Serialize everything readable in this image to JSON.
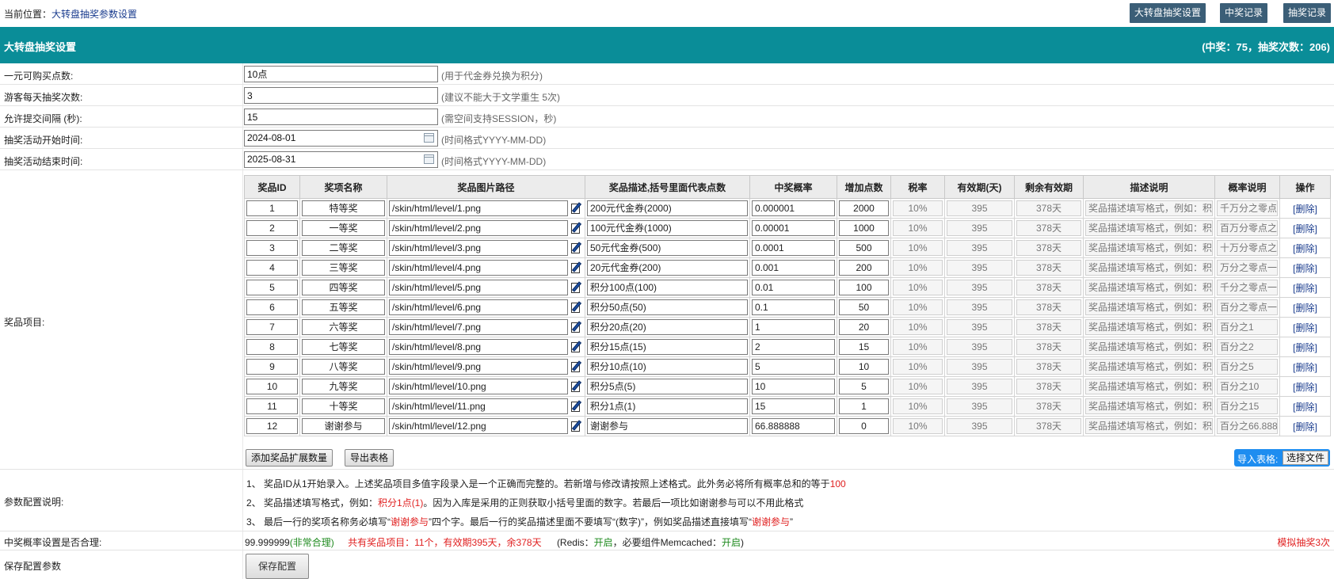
{
  "breadcrumb": {
    "prefix": "当前位置：",
    "link": "大转盘抽奖参数设置"
  },
  "top_buttons": [
    "大转盘抽奖设置",
    "中奖记录",
    "抽奖记录"
  ],
  "panel": {
    "title": "大转盘抽奖设置",
    "stats": "(中奖：75，抽奖次数：206)"
  },
  "fields": [
    {
      "label": "一元可购买点数:",
      "value": "10点",
      "hint": "(用于代金券兑换为积分)"
    },
    {
      "label": "游客每天抽奖次数:",
      "value": "3",
      "hint": "(建议不能大于文学重生 5次)"
    },
    {
      "label": "允许提交间隔 (秒):",
      "value": "15",
      "hint": "(需空间支持SESSION，秒)"
    },
    {
      "label": "抽奖活动开始时间:",
      "value": "2024-08-01",
      "hint": "(时间格式YYYY-MM-DD)"
    },
    {
      "label": "抽奖活动结束时间:",
      "value": "2025-08-31",
      "hint": "(时间格式YYYY-MM-DD)"
    }
  ],
  "prize_section_label": "奖品项目:",
  "table": {
    "headers": [
      "奖品ID",
      "奖项名称",
      "奖品图片路径",
      "奖品描述,括号里面代表点数",
      "中奖概率",
      "增加点数",
      "税率",
      "有效期(天)",
      "剩余有效期",
      "描述说明",
      "概率说明",
      "操作"
    ],
    "rows": [
      {
        "id": "1",
        "name": "特等奖",
        "path": "/skin/html/level/1.png",
        "desc": "200元代金券(2000)",
        "prob": "0.000001",
        "points": "2000",
        "tax": "10%",
        "valid": "395",
        "remain": "378天",
        "explain": "奖品描述填写格式，例如：积",
        "prob_note": "千万分之零点",
        "op": "[删除]"
      },
      {
        "id": "2",
        "name": "一等奖",
        "path": "/skin/html/level/2.png",
        "desc": "100元代金券(1000)",
        "prob": "0.00001",
        "points": "1000",
        "tax": "10%",
        "valid": "395",
        "remain": "378天",
        "explain": "奖品描述填写格式，例如：积",
        "prob_note": "百万分零点之",
        "op": "[删除]"
      },
      {
        "id": "3",
        "name": "二等奖",
        "path": "/skin/html/level/3.png",
        "desc": "50元代金券(500)",
        "prob": "0.0001",
        "points": "500",
        "tax": "10%",
        "valid": "395",
        "remain": "378天",
        "explain": "奖品描述填写格式，例如：积",
        "prob_note": "十万分零点之",
        "op": "[删除]"
      },
      {
        "id": "4",
        "name": "三等奖",
        "path": "/skin/html/level/4.png",
        "desc": "20元代金券(200)",
        "prob": "0.001",
        "points": "200",
        "tax": "10%",
        "valid": "395",
        "remain": "378天",
        "explain": "奖品描述填写格式，例如：积",
        "prob_note": "万分之零点一",
        "op": "[删除]"
      },
      {
        "id": "5",
        "name": "四等奖",
        "path": "/skin/html/level/5.png",
        "desc": "积分100点(100)",
        "prob": "0.01",
        "points": "100",
        "tax": "10%",
        "valid": "395",
        "remain": "378天",
        "explain": "奖品描述填写格式，例如：积",
        "prob_note": "千分之零点一",
        "op": "[删除]"
      },
      {
        "id": "6",
        "name": "五等奖",
        "path": "/skin/html/level/6.png",
        "desc": "积分50点(50)",
        "prob": "0.1",
        "points": "50",
        "tax": "10%",
        "valid": "395",
        "remain": "378天",
        "explain": "奖品描述填写格式，例如：积",
        "prob_note": "百分之零点一",
        "op": "[删除]"
      },
      {
        "id": "7",
        "name": "六等奖",
        "path": "/skin/html/level/7.png",
        "desc": "积分20点(20)",
        "prob": "1",
        "points": "20",
        "tax": "10%",
        "valid": "395",
        "remain": "378天",
        "explain": "奖品描述填写格式，例如：积",
        "prob_note": "百分之1",
        "op": "[删除]"
      },
      {
        "id": "8",
        "name": "七等奖",
        "path": "/skin/html/level/8.png",
        "desc": "积分15点(15)",
        "prob": "2",
        "points": "15",
        "tax": "10%",
        "valid": "395",
        "remain": "378天",
        "explain": "奖品描述填写格式，例如：积",
        "prob_note": "百分之2",
        "op": "[删除]"
      },
      {
        "id": "9",
        "name": "八等奖",
        "path": "/skin/html/level/9.png",
        "desc": "积分10点(10)",
        "prob": "5",
        "points": "10",
        "tax": "10%",
        "valid": "395",
        "remain": "378天",
        "explain": "奖品描述填写格式，例如：积",
        "prob_note": "百分之5",
        "op": "[删除]"
      },
      {
        "id": "10",
        "name": "九等奖",
        "path": "/skin/html/level/10.png",
        "desc": "积分5点(5)",
        "prob": "10",
        "points": "5",
        "tax": "10%",
        "valid": "395",
        "remain": "378天",
        "explain": "奖品描述填写格式，例如：积",
        "prob_note": "百分之10",
        "op": "[删除]"
      },
      {
        "id": "11",
        "name": "十等奖",
        "path": "/skin/html/level/11.png",
        "desc": "积分1点(1)",
        "prob": "15",
        "points": "1",
        "tax": "10%",
        "valid": "395",
        "remain": "378天",
        "explain": "奖品描述填写格式，例如：积",
        "prob_note": "百分之15",
        "op": "[删除]"
      },
      {
        "id": "12",
        "name": "谢谢参与",
        "path": "/skin/html/level/12.png",
        "desc": "谢谢参与",
        "prob": "66.888888",
        "points": "0",
        "tax": "10%",
        "valid": "395",
        "remain": "378天",
        "explain": "奖品描述填写格式，例如：积",
        "prob_note": "百分之66.888",
        "op": "[删除]"
      }
    ]
  },
  "buttons": {
    "add": "添加奖品扩展数量",
    "export": "导出表格",
    "import_label": "导入表格:",
    "choose_file": "选择文件",
    "save": "保存配置"
  },
  "notes_label": "参数配置说明:",
  "notes": {
    "n1_a": "1、   奖品ID从1开始录入。上述奖品项目多值字段录入是一个正确而完整的。若新增与修改请按照上述格式。此外务必将所有概率总和的等于",
    "n1_b": "100",
    "n2_a": "2、   奖品描述填写格式，例如：",
    "n2_b": "积分1点(1)",
    "n2_c": "。因为入库是采用的正则获取小括号里面的数字。若最后一项比如谢谢参与可以不用此格式",
    "n3_a": "3、   最后一行的奖项名称务必填写“",
    "n3_b": "谢谢参与",
    "n3_c": "”四个字。最后一行的奖品描述里面不要填写“(数字)”，例如奖品描述直接填写“",
    "n3_d": "谢谢参与",
    "n3_e": "”"
  },
  "check": {
    "label": "中奖概率设置是否合理:",
    "value": "99.999999",
    "value_status": "(非常合理)",
    "summary": "共有奖品项目：11个，有效期395天，余378天",
    "redis_a": "(Redis：",
    "redis_b": "开启",
    "redis_c": "，必要组件Memcached：",
    "redis_d": "开启",
    "redis_e": ")",
    "simulate": "模拟抽奖3次"
  },
  "save_label": "保存配置参数"
}
